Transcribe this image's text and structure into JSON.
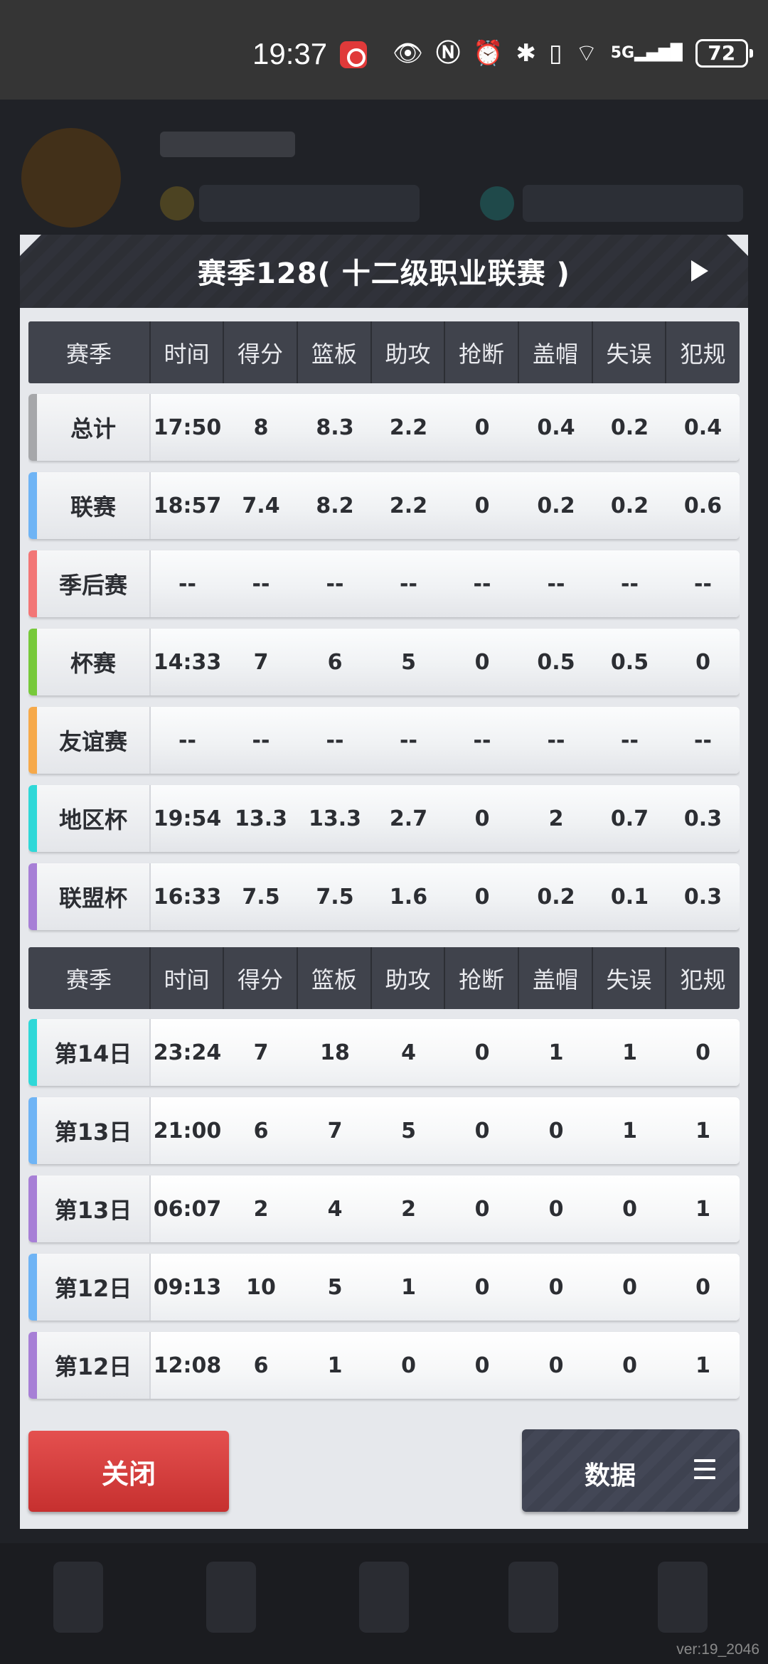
{
  "status_bar": {
    "time": "19:37",
    "battery": "72",
    "network": "5G",
    "icons": [
      "recording-icon",
      "eye-icon",
      "nfc-icon",
      "alarm-icon",
      "bluetooth-icon",
      "vibrate-icon",
      "wifi-icon",
      "signal-icon",
      "battery-icon"
    ]
  },
  "modal": {
    "title": "赛季128( 十二级职业联赛 )",
    "headers": [
      "赛季",
      "时间",
      "得分",
      "篮板",
      "助攻",
      "抢断",
      "盖帽",
      "失误",
      "犯规"
    ],
    "summary_rows": [
      {
        "label": "总计",
        "accent": "#a6a7aa",
        "values": [
          "17:50",
          "8",
          "8.3",
          "2.2",
          "0",
          "0.4",
          "0.2",
          "0.4"
        ]
      },
      {
        "label": "联赛",
        "accent": "#6fb4f5",
        "values": [
          "18:57",
          "7.4",
          "8.2",
          "2.2",
          "0",
          "0.2",
          "0.2",
          "0.6"
        ]
      },
      {
        "label": "季后赛",
        "accent": "#f27676",
        "values": [
          "--",
          "--",
          "--",
          "--",
          "--",
          "--",
          "--",
          "--"
        ]
      },
      {
        "label": "杯赛",
        "accent": "#77c93a",
        "values": [
          "14:33",
          "7",
          "6",
          "5",
          "0",
          "0.5",
          "0.5",
          "0"
        ]
      },
      {
        "label": "友谊赛",
        "accent": "#f6a94a",
        "values": [
          "--",
          "--",
          "--",
          "--",
          "--",
          "--",
          "--",
          "--"
        ]
      },
      {
        "label": "地区杯",
        "accent": "#2fd8d8",
        "values": [
          "19:54",
          "13.3",
          "13.3",
          "2.7",
          "0",
          "2",
          "0.7",
          "0.3"
        ]
      },
      {
        "label": "联盟杯",
        "accent": "#a77fd6",
        "values": [
          "16:33",
          "7.5",
          "7.5",
          "1.6",
          "0",
          "0.2",
          "0.1",
          "0.3"
        ]
      }
    ],
    "game_rows": [
      {
        "label": "第14日",
        "accent": "#2fd8d8",
        "values": [
          "23:24",
          "7",
          "18",
          "4",
          "0",
          "1",
          "1",
          "0"
        ]
      },
      {
        "label": "第13日",
        "accent": "#6fb4f5",
        "values": [
          "21:00",
          "6",
          "7",
          "5",
          "0",
          "0",
          "1",
          "1"
        ]
      },
      {
        "label": "第13日",
        "accent": "#a77fd6",
        "values": [
          "06:07",
          "2",
          "4",
          "2",
          "0",
          "0",
          "0",
          "1"
        ]
      },
      {
        "label": "第12日",
        "accent": "#6fb4f5",
        "values": [
          "09:13",
          "10",
          "5",
          "1",
          "0",
          "0",
          "0",
          "0"
        ]
      },
      {
        "label": "第12日",
        "accent": "#a77fd6",
        "values": [
          "12:08",
          "6",
          "1",
          "0",
          "0",
          "0",
          "0",
          "1"
        ]
      },
      {
        "label": "",
        "accent": "#2fd8d8",
        "values": [
          "",
          "",
          "",
          "",
          "",
          "",
          "",
          ""
        ]
      }
    ],
    "close_label": "关闭",
    "data_label": "数据"
  },
  "version": "ver:19_2046"
}
